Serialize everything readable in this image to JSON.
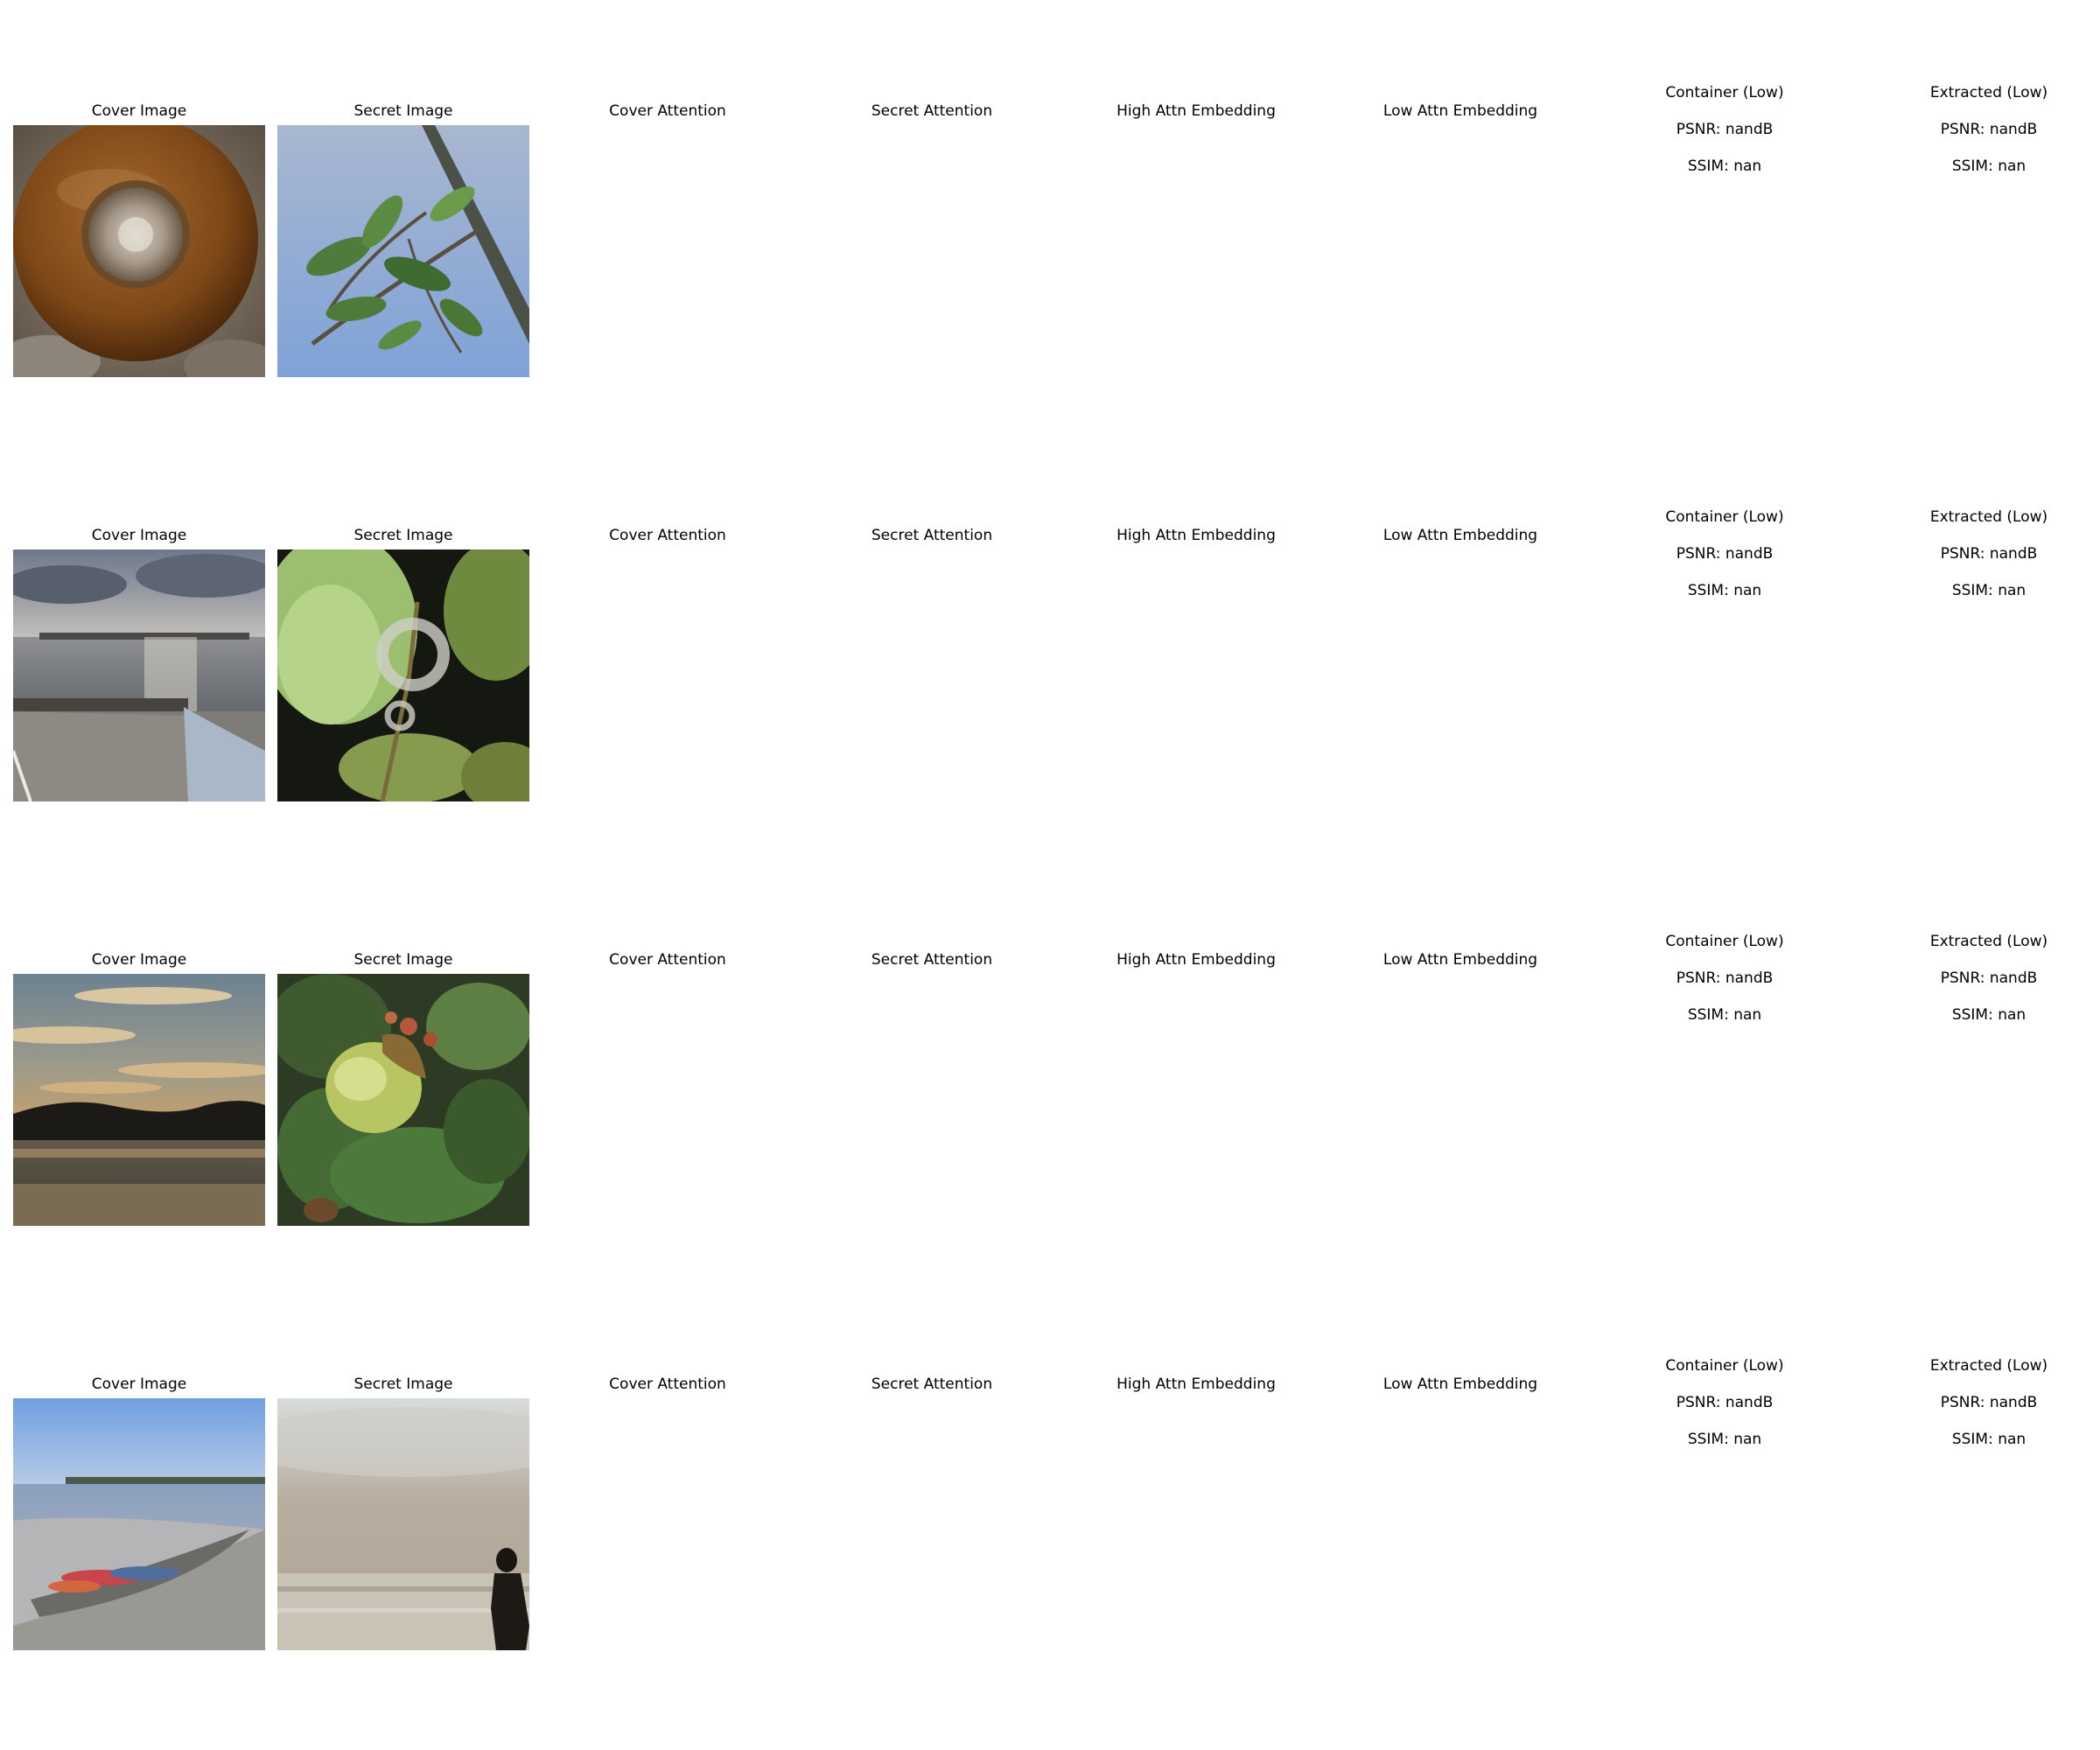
{
  "rows": [
    {
      "cover_title": "Cover Image",
      "secret_title": "Secret Image",
      "cover_attention_title": "Cover Attention",
      "secret_attention_title": "Secret Attention",
      "high_embed_title": "High Attn Embedding",
      "low_embed_title": "Low Attn Embedding",
      "container_title": [
        "Container (Low)",
        "PSNR: nandB",
        "SSIM: nan"
      ],
      "extracted_title": [
        "Extracted (Low)",
        "PSNR: nandB",
        "SSIM: nan"
      ],
      "cover_image": "acorn-top-closeup",
      "secret_image": "oak-branch-against-sky"
    },
    {
      "cover_title": "Cover Image",
      "secret_title": "Secret Image",
      "cover_attention_title": "Cover Attention",
      "secret_attention_title": "Secret Attention",
      "high_embed_title": "High Attn Embedding",
      "low_embed_title": "Low Attn Embedding",
      "container_title": [
        "Container (Low)",
        "PSNR: nandB",
        "SSIM: nan"
      ],
      "extracted_title": [
        "Extracted (Low)",
        "PSNR: nandB",
        "SSIM: nan"
      ],
      "cover_image": "harbor-pier-sunset",
      "secret_image": "green-oak-leaves-dark-background"
    },
    {
      "cover_title": "Cover Image",
      "secret_title": "Secret Image",
      "cover_attention_title": "Cover Attention",
      "secret_attention_title": "Secret Attention",
      "high_embed_title": "High Attn Embedding",
      "low_embed_title": "Low Attn Embedding",
      "container_title": [
        "Container (Low)",
        "PSNR: nandB",
        "SSIM: nan"
      ],
      "extracted_title": [
        "Extracted (Low)",
        "PSNR: nandB",
        "SSIM: nan"
      ],
      "cover_image": "sunset-over-water",
      "secret_image": "green-acorn-on-branch"
    },
    {
      "cover_title": "Cover Image",
      "secret_title": "Secret Image",
      "cover_attention_title": "Cover Attention",
      "secret_attention_title": "Secret Attention",
      "high_embed_title": "High Attn Embedding",
      "low_embed_title": "Low Attn Embedding",
      "container_title": [
        "Container (Low)",
        "PSNR: nandB",
        "SSIM: nan"
      ],
      "extracted_title": [
        "Extracted (Low)",
        "PSNR: nandB",
        "SSIM: nan"
      ],
      "cover_image": "kayaks-on-beach",
      "secret_image": "person-on-hazy-beach"
    }
  ]
}
